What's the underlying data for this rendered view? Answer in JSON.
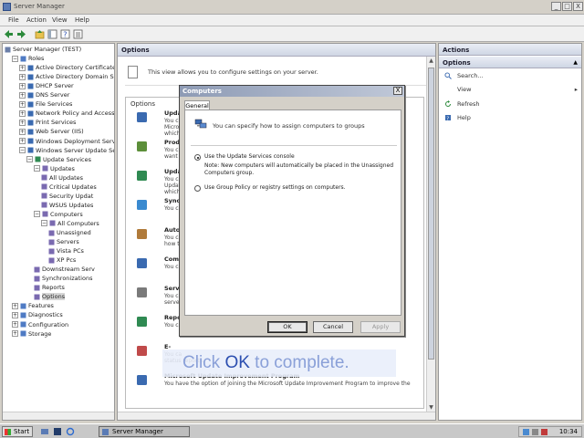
{
  "window": {
    "title": "Server Manager",
    "controls": {
      "minimize": "_",
      "maximize": "□",
      "close": "X"
    }
  },
  "menu": [
    "File",
    "Action",
    "View",
    "Help"
  ],
  "tree": {
    "items": [
      {
        "label": "Server Manager (TEST)",
        "level": 0,
        "expander": ""
      },
      {
        "label": "Roles",
        "level": 1,
        "expander": "−"
      },
      {
        "label": "Active Directory Certificate",
        "level": 2,
        "expander": "+"
      },
      {
        "label": "Active Directory Domain Se",
        "level": 2,
        "expander": "+"
      },
      {
        "label": "DHCP Server",
        "level": 2,
        "expander": "+"
      },
      {
        "label": "DNS Server",
        "level": 2,
        "expander": "+"
      },
      {
        "label": "File Services",
        "level": 2,
        "expander": "+"
      },
      {
        "label": "Network Policy and Access",
        "level": 2,
        "expander": "+"
      },
      {
        "label": "Print Services",
        "level": 2,
        "expander": "+"
      },
      {
        "label": "Web Server (IIS)",
        "level": 2,
        "expander": "+"
      },
      {
        "label": "Windows Deployment Servi",
        "level": 2,
        "expander": "+"
      },
      {
        "label": "Windows Server Update Se",
        "level": 2,
        "expander": "−"
      },
      {
        "label": "Update Services",
        "level": 3,
        "expander": "−"
      },
      {
        "label": "Updates",
        "level": 4,
        "expander": "−"
      },
      {
        "label": "All Updates",
        "level": 5,
        "expander": ""
      },
      {
        "label": "Critical Updates",
        "level": 5,
        "expander": ""
      },
      {
        "label": "Security Updat",
        "level": 5,
        "expander": ""
      },
      {
        "label": "WSUS Updates",
        "level": 5,
        "expander": ""
      },
      {
        "label": "Computers",
        "level": 4,
        "expander": "−"
      },
      {
        "label": "All Computers",
        "level": 5,
        "expander": "−"
      },
      {
        "label": "Unassigned",
        "level": 6,
        "expander": ""
      },
      {
        "label": "Servers",
        "level": 6,
        "expander": ""
      },
      {
        "label": "Vista PCs",
        "level": 6,
        "expander": ""
      },
      {
        "label": "XP Pcs",
        "level": 6,
        "expander": ""
      },
      {
        "label": "Downstream Serv",
        "level": 4,
        "expander": ""
      },
      {
        "label": "Synchronizations",
        "level": 4,
        "expander": ""
      },
      {
        "label": "Reports",
        "level": 4,
        "expander": ""
      },
      {
        "label": "Options",
        "level": 4,
        "expander": "",
        "selected": true
      },
      {
        "label": "Features",
        "level": 1,
        "expander": "+"
      },
      {
        "label": "Diagnostics",
        "level": 1,
        "expander": "+"
      },
      {
        "label": "Configuration",
        "level": 1,
        "expander": "+"
      },
      {
        "label": "Storage",
        "level": 1,
        "expander": "+"
      }
    ]
  },
  "center": {
    "header": "Options",
    "description": "This view allows you to configure settings on your server.",
    "options_header": "Options",
    "items": [
      {
        "title": "Update",
        "desc": [
          "You c",
          "Micros",
          "which"
        ]
      },
      {
        "title": "Produc",
        "desc": [
          "You c",
          "want"
        ]
      },
      {
        "title": "Update",
        "desc": [
          "You ca",
          "Updat",
          "which"
        ]
      },
      {
        "title": "Synchr",
        "desc": [
          "You ca"
        ]
      },
      {
        "title": "Autom",
        "desc": [
          "You ca",
          "how to"
        ]
      },
      {
        "title": "Compu",
        "desc": [
          "You ca"
        ]
      },
      {
        "title": "Server",
        "desc": [
          "You ca",
          "server."
        ]
      },
      {
        "title": "Reporting Rollup",
        "desc": [
          "You can choose to have replica downstream servers roll up computer and update status"
        ]
      },
      {
        "title": "E-",
        "desc": [
          "You ca",
          "status reports."
        ]
      },
      {
        "title": "Microsoft Update Improvement Program",
        "desc": [
          "You have the option of joining the Microsoft Update Improvement Program to improve the"
        ]
      }
    ],
    "scroll": {
      "up": "▲",
      "down": "▼"
    }
  },
  "actions": {
    "header": "Actions",
    "section": "Options",
    "items": [
      "Search...",
      "View",
      "Refresh",
      "Help"
    ],
    "view_arrow": "▸",
    "collapse_arrow": "▲"
  },
  "dialog": {
    "title": "Computers",
    "close": "X",
    "tab": "General",
    "header_text": "You can specify how to assign computers to groups",
    "option1_label": "Use the Update Services console",
    "option1_note_line1": "Note: New computers will automatically be placed in the Unassigned",
    "option1_note_line2": "Computers group.",
    "option2_label": "Use Group Policy or registry settings on computers.",
    "selected_option": 1,
    "buttons": {
      "ok": "OK",
      "cancel": "Cancel",
      "apply": "Apply"
    }
  },
  "callout": {
    "before": "Click ",
    "highlight": "OK",
    "after": " to complete."
  },
  "taskbar": {
    "start": "Start",
    "task": "Server Manager",
    "clock": "10:34"
  },
  "colors": {
    "callout_text": "#8aa0d8",
    "callout_highlight": "#2c4fb0",
    "pane_header": "#cfd6e4"
  }
}
